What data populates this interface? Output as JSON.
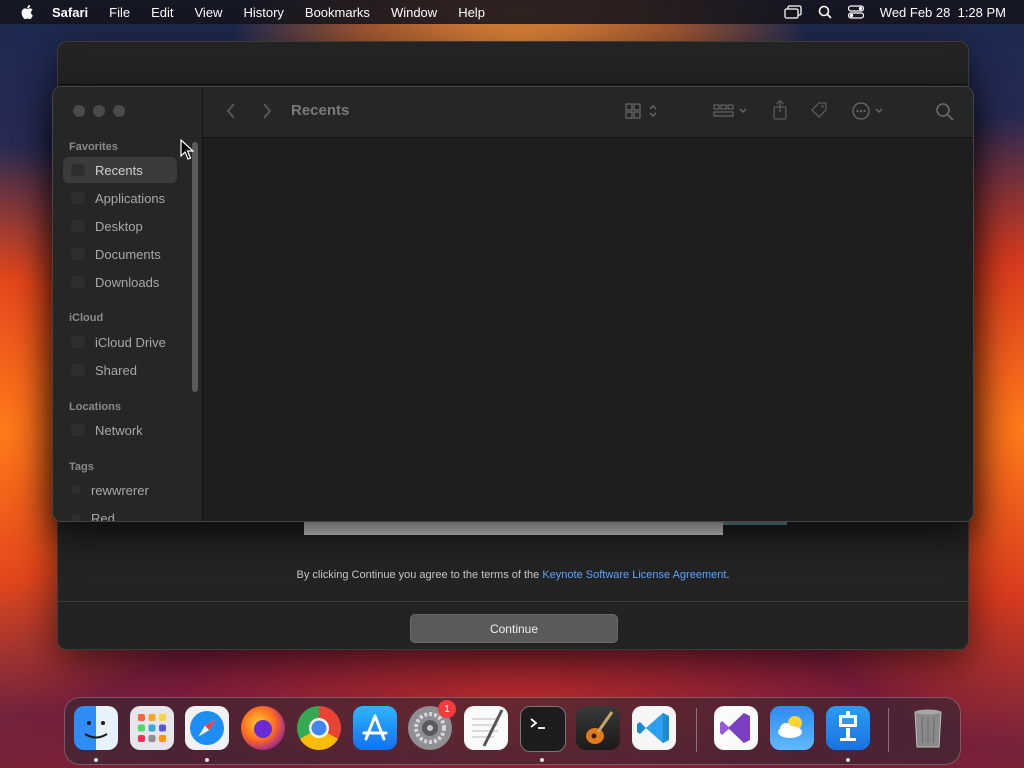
{
  "menubar": {
    "app_name": "Safari",
    "items": [
      "File",
      "Edit",
      "View",
      "History",
      "Bookmarks",
      "Window",
      "Help"
    ],
    "datetime": "Wed Feb 28  1:28 PM"
  },
  "finder": {
    "title": "Recents",
    "sections": {
      "favorites": "Favorites",
      "icloud": "iCloud",
      "locations": "Locations",
      "tags": "Tags"
    },
    "favorites": [
      "Recents",
      "Applications",
      "Desktop",
      "Documents",
      "Downloads"
    ],
    "icloud": [
      "iCloud Drive",
      "Shared"
    ],
    "locations": [
      "Network"
    ],
    "tags": [
      "rewwrerer",
      "Red"
    ],
    "selected": "Recents"
  },
  "installer": {
    "terms_prefix": "By clicking Continue you agree to the terms of the",
    "terms_link": "Keynote Software License Agreement",
    "terms_suffix": ".",
    "continue_label": "Continue"
  },
  "dock": {
    "apps": [
      "finder",
      "launchpad",
      "safari",
      "firefox",
      "chrome",
      "app-store",
      "system-settings",
      "textedit",
      "terminal",
      "garageband",
      "vscode",
      "visual-studio",
      "weather",
      "keynote",
      "trash"
    ],
    "system_settings_badge": "1"
  }
}
